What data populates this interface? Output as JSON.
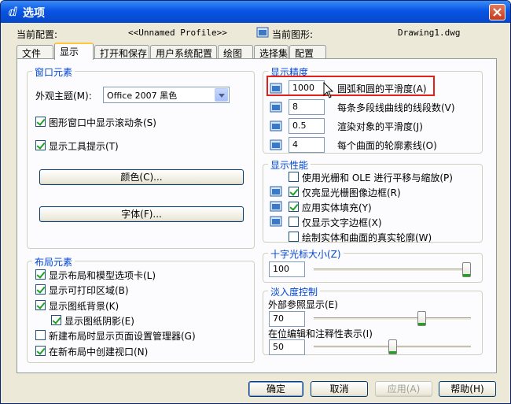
{
  "window": {
    "title": "选项",
    "app_icon": "autocad-icon",
    "close_icon": "close-icon"
  },
  "header": {
    "current_profile_label": "当前配置:",
    "current_profile_value": "<<Unnamed Profile>>",
    "current_drawing_label": "当前图形:",
    "current_drawing_value": "Drawing1.dwg"
  },
  "tabs": [
    {
      "label": "文件"
    },
    {
      "label": "显示",
      "active": true
    },
    {
      "label": "打开和保存"
    },
    {
      "label": "用户系统配置"
    },
    {
      "label": "绘图"
    },
    {
      "label": "选择集"
    },
    {
      "label": "配置"
    }
  ],
  "window_elements": {
    "title": "窗口元素",
    "theme_label": "外观主题(M):",
    "theme_value": "Office 2007 黑色",
    "show_scrollbars_label": "图形窗口中显示滚动条(S)",
    "show_scrollbars": true,
    "show_tooltips_label": "显示工具提示(T)",
    "show_tooltips": true,
    "colors_button": "颜色(C)...",
    "fonts_button": "字体(F)..."
  },
  "layout_elements": {
    "title": "布局元素",
    "items": [
      {
        "label": "显示布局和模型选项卡(L)",
        "checked": true
      },
      {
        "label": "显示可打印区域(B)",
        "checked": true
      },
      {
        "label": "显示图纸背景(K)",
        "checked": true
      },
      {
        "label": "显示图纸阴影(E)",
        "checked": true
      },
      {
        "label": "新建布局时显示页面设置管理器(G)",
        "checked": false
      },
      {
        "label": "在新布局中创建视口(N)",
        "checked": true
      }
    ]
  },
  "display_resolution": {
    "title": "显示精度",
    "items": [
      {
        "value": "1000",
        "label": "圆弧和圆的平滑度(A)"
      },
      {
        "value": "8",
        "label": "每条多段线曲线的线段数(V)"
      },
      {
        "value": "0.5",
        "label": "渲染对象的平滑度(J)"
      },
      {
        "value": "4",
        "label": "每个曲面的轮廓素线(O)"
      }
    ]
  },
  "display_performance": {
    "title": "显示性能",
    "items": [
      {
        "label": "使用光栅和 OLE 进行平移与缩放(P)",
        "checked": false
      },
      {
        "label": "仅亮显光栅图像边框(R)",
        "checked": true
      },
      {
        "label": "应用实体填充(Y)",
        "checked": true
      },
      {
        "label": "仅显示文字边框(X)",
        "checked": false
      },
      {
        "label": "绘制实体和曲面的真实轮廓(W)",
        "checked": false
      }
    ]
  },
  "crosshair": {
    "title": "十字光标大小(Z)",
    "value": "100",
    "level_fraction": 1.0
  },
  "fade": {
    "title": "淡入度控制",
    "xref_label": "外部参照显示(E)",
    "xref_value": "70",
    "xref_level": 0.7,
    "inplace_label": "在位编辑和注释性表示(I)",
    "inplace_value": "50",
    "inplace_level": 0.5
  },
  "buttons": {
    "ok": "确定",
    "cancel": "取消",
    "apply": "应用(A)",
    "help": "帮助(H)"
  },
  "colors": {
    "title_bar": "#0955e5",
    "group_title": "#0046d5",
    "highlight": "#e0201b",
    "check": "#21a121"
  }
}
